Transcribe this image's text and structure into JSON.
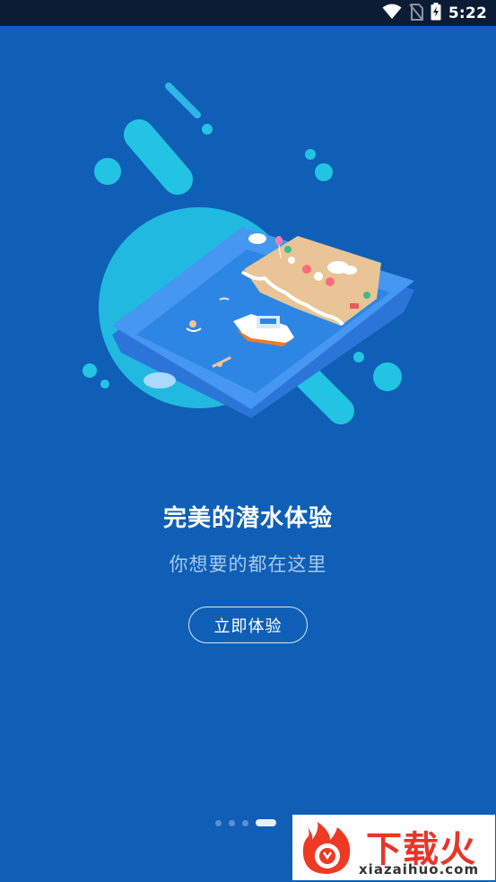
{
  "status_bar": {
    "time": "5:22",
    "icons": [
      "wifi-icon",
      "no-sim-icon",
      "battery-charging-icon"
    ]
  },
  "onboarding": {
    "title": "完美的潜水体验",
    "subtitle": "你想要的都在这里",
    "cta_label": "立即体验",
    "page_indicator": {
      "total": 4,
      "current": 4
    }
  },
  "watermark": {
    "title": "下载火",
    "url": "xiazaihuo.com"
  },
  "colors": {
    "background": "#0e5fb5",
    "accent_cyan": "#23c4e3",
    "tablet_blue": "#3f8df0",
    "watermark_red": "#e8352a"
  }
}
